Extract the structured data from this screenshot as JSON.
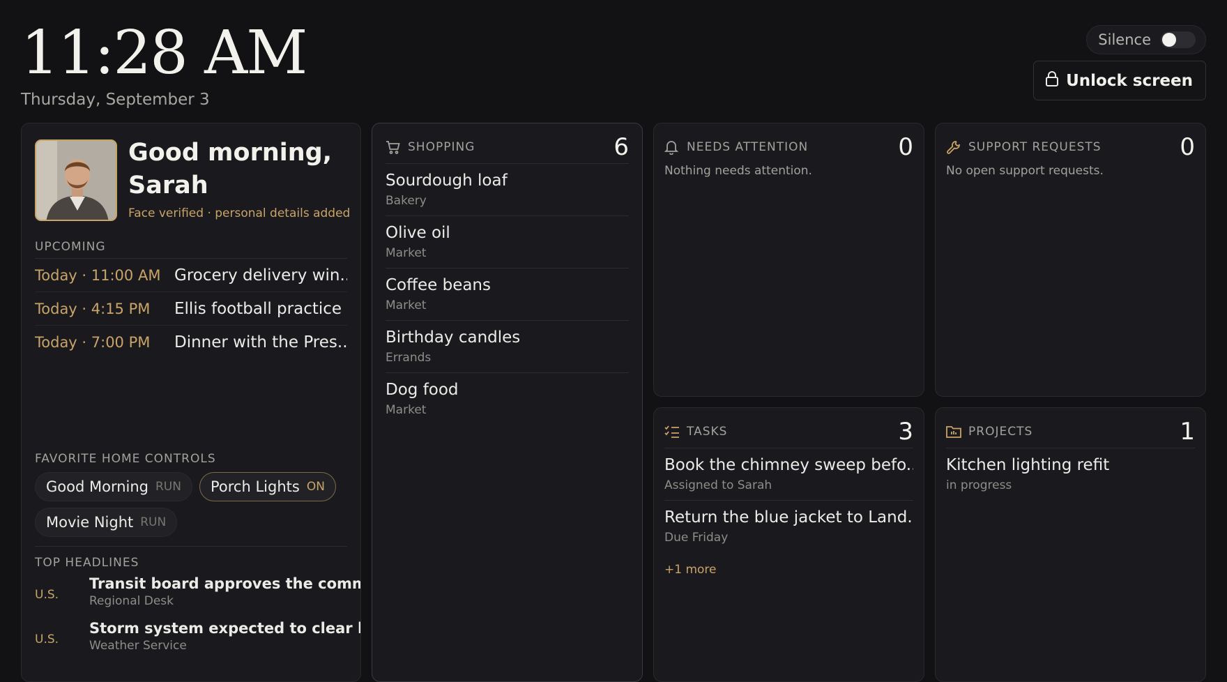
{
  "header": {
    "time": "11:28 AM",
    "date": "Thursday, September 3",
    "silence_label": "Silence",
    "silence_on": false,
    "unlock_label": "Unlock screen"
  },
  "greeting": {
    "title": "Good morning, Sarah",
    "subtitle": "Face verified · personal details added"
  },
  "upcoming": {
    "label": "UPCOMING",
    "items": [
      {
        "time": "Today · 11:00 AM",
        "text": "Grocery delivery win..."
      },
      {
        "time": "Today · 4:15 PM",
        "text": "Ellis football practice"
      },
      {
        "time": "Today · 7:00 PM",
        "text": "Dinner with the Pres..."
      }
    ]
  },
  "home_controls": {
    "label": "FAVORITE HOME CONTROLS",
    "items": [
      {
        "name": "Good Morning",
        "state": "RUN"
      },
      {
        "name": "Porch Lights",
        "state": "ON"
      },
      {
        "name": "Movie Night",
        "state": "RUN"
      }
    ]
  },
  "headlines": {
    "label": "TOP HEADLINES",
    "items": [
      {
        "source": "U.S.",
        "title": "Transit board approves the comm...",
        "meta": "Regional Desk"
      },
      {
        "source": "U.S.",
        "title": "Storm system expected to clear b...",
        "meta": "Weather Service"
      }
    ]
  },
  "shopping": {
    "label": "SHOPPING",
    "count": "6",
    "icon": "cart-icon",
    "items": [
      {
        "title": "Sourdough loaf",
        "sub": "Bakery"
      },
      {
        "title": "Olive oil",
        "sub": "Market"
      },
      {
        "title": "Coffee beans",
        "sub": "Market"
      },
      {
        "title": "Birthday candles",
        "sub": "Errands"
      },
      {
        "title": "Dog food",
        "sub": "Market"
      }
    ]
  },
  "needs_attention": {
    "label": "NEEDS ATTENTION",
    "count": "0",
    "icon": "bell-icon",
    "empty": "Nothing needs attention."
  },
  "support": {
    "label": "SUPPORT REQUESTS",
    "count": "0",
    "icon": "wrench-icon",
    "empty": "No open support requests."
  },
  "tasks": {
    "label": "TASKS",
    "count": "3",
    "icon": "checklist-icon",
    "items": [
      {
        "title": "Book the chimney sweep befo...",
        "sub": "Assigned to Sarah"
      },
      {
        "title": "Return the blue jacket to Land...",
        "sub": "Due Friday"
      }
    ],
    "more": "+1 more"
  },
  "projects": {
    "label": "PROJECTS",
    "count": "1",
    "icon": "folder-icon",
    "items": [
      {
        "title": "Kitchen lighting refit",
        "sub": "in progress"
      }
    ]
  },
  "colors": {
    "background": "#121215",
    "panel": "#1a1a1e",
    "accent": "#c9a468",
    "text": "#ecebe7",
    "muted": "#a3a19b"
  }
}
